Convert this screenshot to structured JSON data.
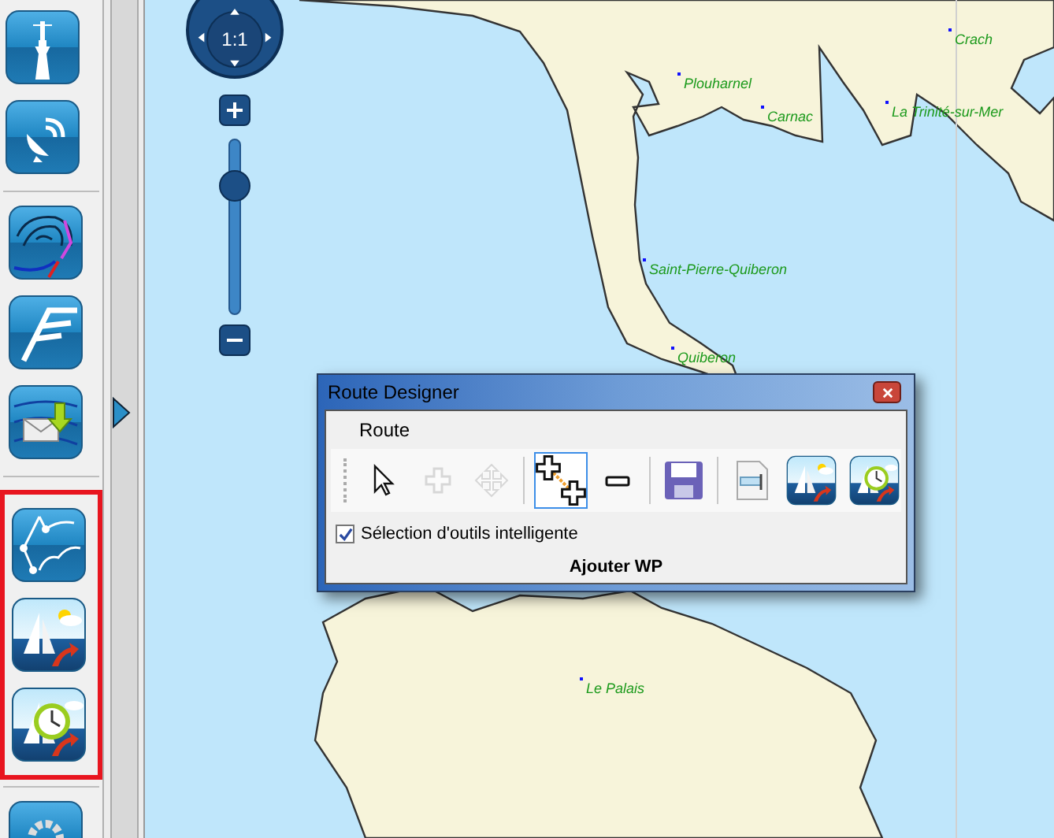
{
  "sidebar": {
    "groups": [
      {
        "highlighted": false,
        "items": [
          {
            "kind": "buoy"
          },
          {
            "kind": "satellite"
          }
        ]
      },
      {
        "highlighted": false,
        "items": [
          {
            "kind": "isobars"
          },
          {
            "kind": "wind"
          },
          {
            "kind": "grib-mail"
          }
        ]
      },
      {
        "highlighted": true,
        "items": [
          {
            "kind": "route"
          },
          {
            "kind": "sail-weather"
          },
          {
            "kind": "sail-clock"
          }
        ]
      },
      {
        "highlighted": false,
        "items": [
          {
            "kind": "gear"
          }
        ]
      }
    ]
  },
  "map": {
    "zoom_control": {
      "ratio_label": "1:1",
      "level": 0.78
    },
    "places": [
      {
        "name": "Crach"
      },
      {
        "name": "Plouharnel"
      },
      {
        "name": "Carnac"
      },
      {
        "name": "La Trinité-sur-Mer"
      },
      {
        "name": "Saint-Pierre-Quiberon"
      },
      {
        "name": "Quiberon"
      },
      {
        "name": "Le Palais"
      }
    ]
  },
  "dialog": {
    "title": "Route Designer",
    "menu": [
      "Route"
    ],
    "tools": [
      {
        "kind": "pointer",
        "selected": false,
        "disabled": false
      },
      {
        "kind": "add",
        "selected": false,
        "disabled": true
      },
      {
        "kind": "move",
        "selected": false,
        "disabled": true
      },
      {
        "kind": "add-waypoint",
        "selected": true,
        "disabled": false
      },
      {
        "kind": "remove",
        "selected": false,
        "disabled": false
      },
      {
        "kind": "save",
        "selected": false,
        "disabled": false
      },
      {
        "kind": "export",
        "selected": false,
        "disabled": false
      },
      {
        "kind": "sail-weather",
        "selected": false,
        "disabled": false
      },
      {
        "kind": "sail-clock",
        "selected": false,
        "disabled": false
      }
    ],
    "smart_select": {
      "label": "Sélection d'outils intelligente",
      "checked": true
    },
    "status": "Ajouter WP"
  }
}
